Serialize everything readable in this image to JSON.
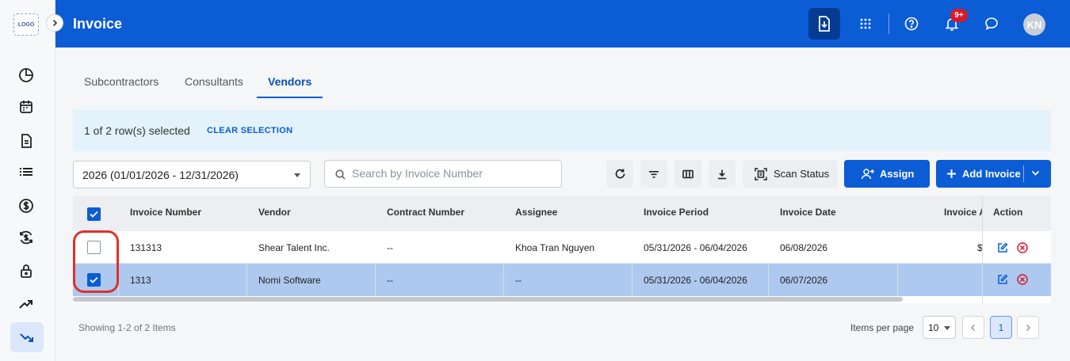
{
  "brand": {
    "logo_text": "LOGO",
    "primary_color": "#0b5cd5"
  },
  "sidebar": {
    "items": [
      {
        "name": "pie-chart-icon"
      },
      {
        "name": "calendar-icon"
      },
      {
        "name": "document-icon"
      },
      {
        "name": "list-icon"
      },
      {
        "name": "dollar-circle-icon"
      },
      {
        "name": "dollar-refresh-icon"
      },
      {
        "name": "lock-icon"
      },
      {
        "name": "trending-up-icon"
      },
      {
        "name": "trending-down-icon",
        "active": true
      }
    ]
  },
  "header": {
    "title": "Invoice",
    "notification_badge": "9+",
    "avatar_initials": "KN",
    "icons": [
      "download-icon",
      "apps-grid-icon",
      "help-icon",
      "bell-icon",
      "chat-icon"
    ]
  },
  "tabs": [
    {
      "label": "Subcontractors",
      "active": false
    },
    {
      "label": "Consultants",
      "active": false
    },
    {
      "label": "Vendors",
      "active": true
    }
  ],
  "selection": {
    "text": "1 of 2 row(s) selected",
    "clear_label": "CLEAR SELECTION"
  },
  "toolbar": {
    "period_value": "2026 (01/01/2026 - 12/31/2026)",
    "search_placeholder": "Search by Invoice Number",
    "scan_status_label": "Scan Status",
    "assign_label": "Assign",
    "add_invoice_label": "Add Invoice"
  },
  "table": {
    "columns": [
      "Invoice Number",
      "Vendor",
      "Contract Number",
      "Assignee",
      "Invoice Period",
      "Invoice Date",
      "Invoice A",
      "Action"
    ],
    "rows": [
      {
        "selected": false,
        "invoice_number": "131313",
        "vendor": "Shear Talent Inc.",
        "contract_number": "--",
        "assignee": "Khoa Tran Nguyen",
        "invoice_period": "05/31/2026 - 06/04/2026",
        "invoice_date": "06/08/2026",
        "invoice_amount": "$"
      },
      {
        "selected": true,
        "invoice_number": "1313",
        "vendor": "Nomi Software",
        "contract_number": "--",
        "assignee": "--",
        "invoice_period": "05/31/2026 - 06/04/2026",
        "invoice_date": "06/07/2026",
        "invoice_amount": ""
      }
    ]
  },
  "footer": {
    "showing": "Showing 1-2 of 2 Items",
    "items_per_page_label": "Items per page",
    "items_per_page_value": "10",
    "current_page": "1"
  }
}
